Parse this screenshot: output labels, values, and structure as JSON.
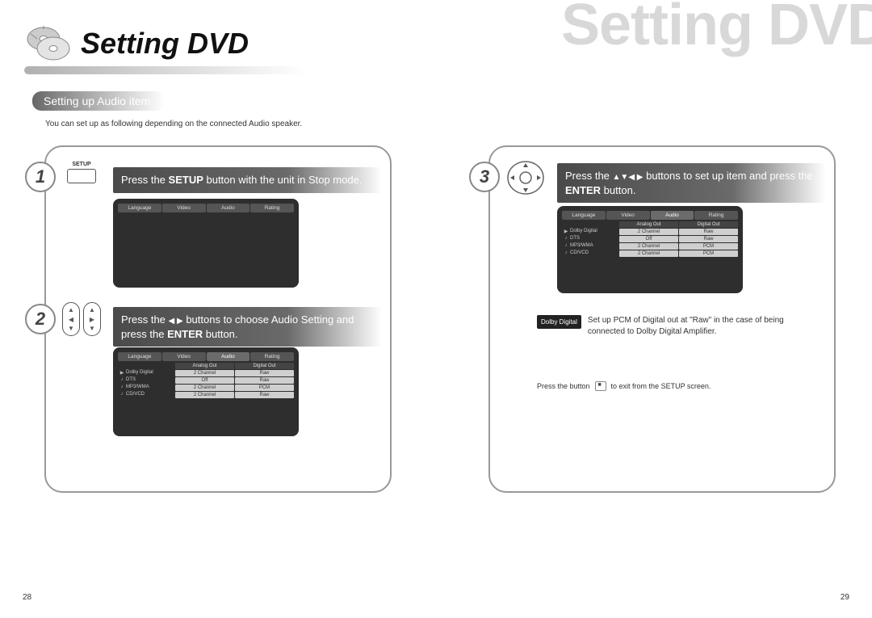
{
  "watermark": "Setting DVD",
  "page_title": "Setting DVD",
  "section_pill": "Setting up Audio item",
  "intro_text": "You can set up as following depending on the connected Audio speaker.",
  "steps": {
    "s1": {
      "num": "1",
      "icon_label": "SETUP",
      "text_pre": "Press the ",
      "text_bold": "SETUP",
      "text_post": " button with the unit in Stop mode."
    },
    "s2": {
      "num": "2",
      "text_pre": "Press the ",
      "arrows": "◀ ▶",
      "text_mid": " buttons to choose Audio Setting and press the ",
      "text_bold": "ENTER",
      "text_post": " button."
    },
    "s3": {
      "num": "3",
      "text_pre": "Press the ",
      "arrows": "▲▼◀ ▶",
      "text_mid": " buttons to set up item and press the ",
      "text_bold": "ENTER",
      "text_post": " button."
    }
  },
  "osd": {
    "tabs": [
      "Language",
      "Video",
      "Audio",
      "Rating"
    ],
    "active_tab_index": 2,
    "subheaders": [
      "Analog Out",
      "Digital Out"
    ],
    "rows": [
      {
        "icon": "▶",
        "label": "Dolby Digital",
        "analog": "2 Channel",
        "digital": "Raw"
      },
      {
        "icon": "♪",
        "label": "DTS",
        "analog": "Off",
        "digital": "Raw"
      },
      {
        "icon": "♪",
        "label": "MP3/WMA",
        "analog": "2 Channel",
        "digital": "PCM"
      },
      {
        "icon": "♪",
        "label": "CD/VCD",
        "analog": "2 Channel",
        "digital": "Raw"
      }
    ],
    "rows_alt_last_digital": "PCM"
  },
  "notes": {
    "dolby_badge": "Dolby Digital",
    "dolby_text": "Set up PCM of Digital out at \"Raw\" in the case of being connected to Dolby Digital Amplifier.",
    "exit_pre": "Press the button",
    "exit_post": "to exit from the SETUP screen."
  },
  "page_numbers": {
    "left": "28",
    "right": "29"
  }
}
